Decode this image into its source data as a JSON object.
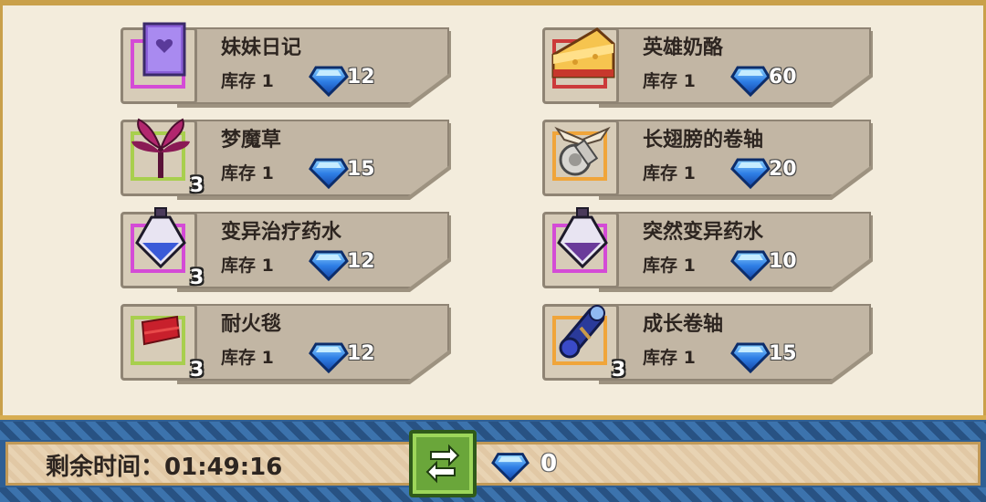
{
  "shop": {
    "items": [
      {
        "name": "妹妹日记",
        "stock": "库存 1",
        "price": "12",
        "qty": "",
        "icon": "diary-icon",
        "frame": "purple"
      },
      {
        "name": "英雄奶酪",
        "stock": "库存 1",
        "price": "60",
        "qty": "",
        "icon": "cheese-icon",
        "frame": "red"
      },
      {
        "name": "梦魔草",
        "stock": "库存 1",
        "price": "15",
        "qty": "3",
        "icon": "herb-icon",
        "frame": "green"
      },
      {
        "name": "长翅膀的卷轴",
        "stock": "库存 1",
        "price": "20",
        "qty": "",
        "icon": "winged-scroll-icon",
        "frame": "orange"
      },
      {
        "name": "变异治疗药水",
        "stock": "库存 1",
        "price": "12",
        "qty": "3",
        "icon": "healing-potion-icon",
        "frame": "purple"
      },
      {
        "name": "突然变异药水",
        "stock": "库存 1",
        "price": "10",
        "qty": "",
        "icon": "mutation-potion-icon",
        "frame": "purple"
      },
      {
        "name": "耐火毯",
        "stock": "库存 1",
        "price": "12",
        "qty": "3",
        "icon": "fireproof-blanket-icon",
        "frame": "green"
      },
      {
        "name": "成长卷轴",
        "stock": "库存 1",
        "price": "15",
        "qty": "3",
        "icon": "growth-scroll-icon",
        "frame": "orange"
      }
    ]
  },
  "footer": {
    "timer_label": "剩余时间：",
    "timer_value": "01:49:16",
    "gem_count": "0",
    "refresh_icon": "refresh-icon",
    "gem_icon": "diamond-icon"
  },
  "colors": {
    "background": "#f3ecdc",
    "card": "#c2b6a4",
    "gem": "#2f7fe6",
    "bottom_bar": "#2f5f94",
    "refresh": "#6aa63a"
  }
}
